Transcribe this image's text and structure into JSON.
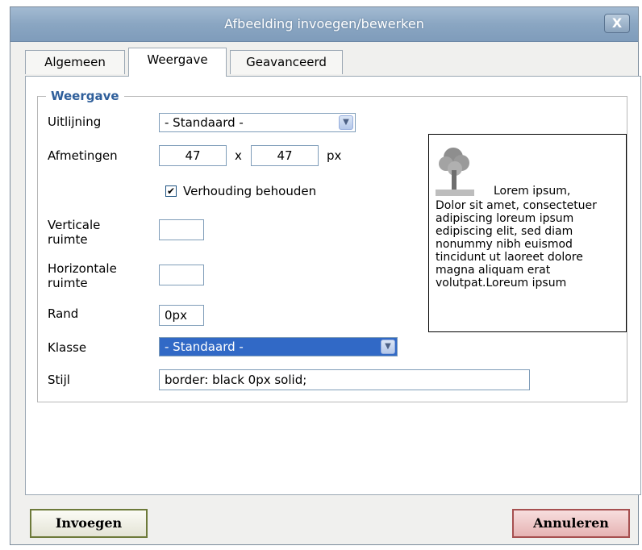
{
  "dialog": {
    "title": "Afbeelding invoegen/bewerken",
    "close_label": "X"
  },
  "tabs": [
    {
      "label": "Algemeen",
      "active": false
    },
    {
      "label": "Weergave",
      "active": true
    },
    {
      "label": "Geavanceerd",
      "active": false
    }
  ],
  "fieldset": {
    "legend": "Weergave"
  },
  "form": {
    "alignment_label": "Uitlijning",
    "alignment_value": "- Standaard -",
    "dimensions_label": "Afmetingen",
    "width_value": "47",
    "times": "x",
    "height_value": "47",
    "unit": "px",
    "keep_ratio_label": "Verhouding behouden",
    "keep_ratio_checked": true,
    "vspace_label_1": "Verticale",
    "vspace_label_2": "ruimte",
    "vspace_value": "",
    "hspace_label_1": "Horizontale",
    "hspace_label_2": "ruimte",
    "hspace_value": "",
    "border_label": "Rand",
    "border_value": "0px",
    "class_label": "Klasse",
    "class_value": "- Standaard -",
    "style_label": "Stijl",
    "style_value": "border: black 0px solid;"
  },
  "preview": {
    "text_first_line": "Lorem ipsum,",
    "text_rest": "Dolor sit amet, consectetuer adipiscing loreum ipsum edipiscing elit, sed diam nonummy nibh euismod tincidunt ut laoreet dolore magna aliquam erat volutpat.Loreum ipsum"
  },
  "buttons": {
    "insert": "Invoegen",
    "cancel": "Annuleren"
  },
  "colors": {
    "titlebar": "#8aa6c2",
    "legend": "#2f5f9b",
    "highlight": "#3169c6",
    "insert_border": "#6d7a3a",
    "cancel_border": "#a65050"
  }
}
